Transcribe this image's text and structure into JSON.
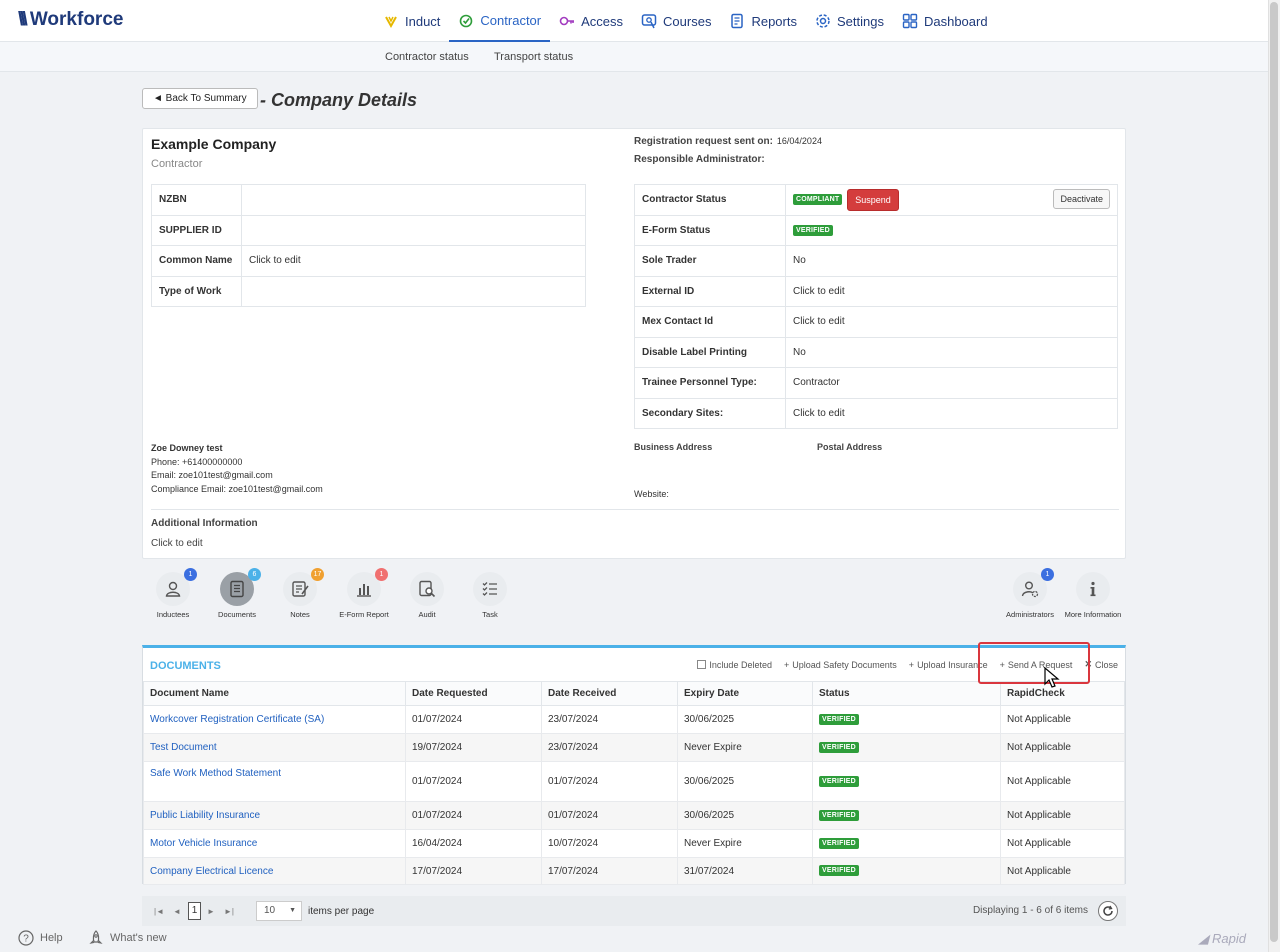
{
  "app": {
    "name": "Workforce"
  },
  "nav": {
    "items": [
      {
        "label": "Induct",
        "icon": "induct-icon",
        "color": "#e6b800"
      },
      {
        "label": "Contractor",
        "icon": "contractor-icon",
        "color": "#2e9d3a",
        "active": true
      },
      {
        "label": "Access",
        "icon": "key-icon",
        "color": "#a23bbf"
      },
      {
        "label": "Courses",
        "icon": "courses-icon",
        "color": "#2a64c4"
      },
      {
        "label": "Reports",
        "icon": "reports-icon",
        "color": "#2a64c4"
      },
      {
        "label": "Settings",
        "icon": "gear-icon",
        "color": "#2a64c4"
      },
      {
        "label": "Dashboard",
        "icon": "dashboard-icon",
        "color": "#2a64c4"
      }
    ],
    "sub": [
      "Contractor status",
      "Transport status"
    ]
  },
  "header": {
    "back_label": "◄ Back To Summary",
    "title": "- Company Details"
  },
  "company": {
    "name": "Example Company",
    "type": "Contractor",
    "registration_label": "Registration request sent on:",
    "registration_date": "16/04/2024",
    "responsible_label": "Responsible Administrator:",
    "left_fields": [
      {
        "label": "NZBN",
        "value": ""
      },
      {
        "label": "SUPPLIER ID",
        "value": ""
      },
      {
        "label": "Common Name",
        "value": "Click to edit"
      },
      {
        "label": "Type of Work",
        "value": ""
      }
    ],
    "right_fields": {
      "contractor_status": {
        "label": "Contractor Status",
        "badge": "COMPLIANT",
        "suspend": "Suspend",
        "deactivate": "Deactivate"
      },
      "eform_status": {
        "label": "E-Form Status",
        "badge": "VERIFIED"
      },
      "rows": [
        {
          "label": "Sole Trader",
          "value": "No"
        },
        {
          "label": "External ID",
          "value": "Click to edit"
        },
        {
          "label": "Mex Contact Id",
          "value": "Click to edit"
        },
        {
          "label": "Disable Label Printing",
          "value": "No"
        },
        {
          "label": "Trainee Personnel Type:",
          "value": "Contractor"
        },
        {
          "label": "Secondary Sites:",
          "value": "Click to edit"
        }
      ]
    },
    "contact": {
      "name": "Zoe Downey test",
      "phone": "Phone: +61400000000",
      "email": "Email: zoe101test@gmail.com",
      "compliance_email": "Compliance Email: zoe101test@gmail.com"
    },
    "business_address_label": "Business Address",
    "postal_address_label": "Postal Address",
    "website_label": "Website:",
    "additional_info_label": "Additional Information",
    "additional_info_value": "Click to edit"
  },
  "toolbar": {
    "left": [
      {
        "label": "Inductees",
        "count": "1",
        "count_color": "#3b6fe0",
        "icon": "inductees-icon"
      },
      {
        "label": "Documents",
        "count": "6",
        "count_color": "#4bb1e8",
        "icon": "documents-icon",
        "selected": true
      },
      {
        "label": "Notes",
        "count": "17",
        "count_color": "#f0a030",
        "icon": "notes-icon"
      },
      {
        "label": "E-Form Report",
        "count": "1",
        "count_color": "#f07070",
        "icon": "eform-report-icon"
      },
      {
        "label": "Audit",
        "count": "",
        "icon": "audit-icon"
      },
      {
        "label": "Task",
        "count": "",
        "icon": "task-icon"
      }
    ],
    "right": [
      {
        "label": "Administrators",
        "count": "1",
        "count_color": "#3b6fe0",
        "icon": "administrators-icon"
      },
      {
        "label": "More Information",
        "count": "",
        "icon": "info-icon"
      }
    ]
  },
  "documents": {
    "title": "DOCUMENTS",
    "include_deleted": "Include Deleted",
    "upload_safety": "Upload Safety Documents",
    "upload_insurance": "Upload Insurance",
    "send_request": "Send A Request",
    "close": "Close",
    "columns": [
      "Document Name",
      "Date Requested",
      "Date Received",
      "Expiry Date",
      "Status",
      "RapidCheck"
    ],
    "rows": [
      {
        "name": "Workcover Registration Certificate (SA)",
        "requested": "01/07/2024",
        "received": "23/07/2024",
        "expiry": "30/06/2025",
        "status": "VERIFIED",
        "rapid": "Not Applicable"
      },
      {
        "name": "Test Document",
        "requested": "19/07/2024",
        "received": "23/07/2024",
        "expiry": "Never Expire",
        "status": "VERIFIED",
        "rapid": "Not Applicable"
      },
      {
        "name": "Safe Work Method Statement",
        "requested": "01/07/2024",
        "received": "01/07/2024",
        "expiry": "30/06/2025",
        "status": "VERIFIED",
        "rapid": "Not Applicable"
      },
      {
        "name": "Public Liability Insurance",
        "requested": "01/07/2024",
        "received": "01/07/2024",
        "expiry": "30/06/2025",
        "status": "VERIFIED",
        "rapid": "Not Applicable"
      },
      {
        "name": "Motor Vehicle Insurance",
        "requested": "16/04/2024",
        "received": "10/07/2024",
        "expiry": "Never Expire",
        "status": "VERIFIED",
        "rapid": "Not Applicable"
      },
      {
        "name": "Company Electrical Licence",
        "requested": "17/07/2024",
        "received": "17/07/2024",
        "expiry": "31/07/2024",
        "status": "VERIFIED",
        "rapid": "Not Applicable"
      }
    ]
  },
  "pager": {
    "page": "1",
    "page_size": "10",
    "items_per_page": "items per page",
    "display": "Displaying 1 - 6 of 6 items"
  },
  "footer": {
    "help": "Help",
    "whats_new": "What's new",
    "brand": "Rapid"
  }
}
